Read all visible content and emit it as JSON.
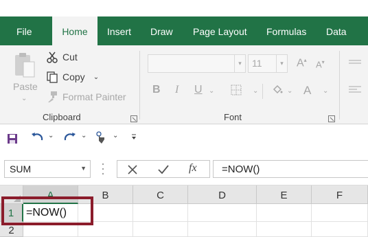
{
  "ribbon_tabs": [
    {
      "label": "File"
    },
    {
      "label": "Home"
    },
    {
      "label": "Insert"
    },
    {
      "label": "Draw"
    },
    {
      "label": "Page Layout"
    },
    {
      "label": "Formulas"
    },
    {
      "label": "Data"
    }
  ],
  "active_tab": "Home",
  "clipboard": {
    "paste_label": "Paste",
    "cut_label": "Cut",
    "copy_label": "Copy",
    "format_painter_label": "Format Painter",
    "group_label": "Clipboard"
  },
  "font": {
    "font_name": "",
    "font_size": "11",
    "group_label": "Font",
    "bold": "B",
    "italic": "I",
    "underline": "U",
    "grow": "A",
    "shrink": "A",
    "font_color": "A"
  },
  "formula_bar": {
    "name_box": "SUM",
    "fx": "fx",
    "formula": "=NOW()"
  },
  "grid": {
    "columns": [
      "A",
      "B",
      "C",
      "D",
      "E",
      "F"
    ],
    "rows": [
      "1",
      "2"
    ],
    "cells": {
      "A1": "=NOW()"
    }
  },
  "colors": {
    "ribbon_green": "#217346",
    "highlight_border": "#8b1c2b"
  }
}
